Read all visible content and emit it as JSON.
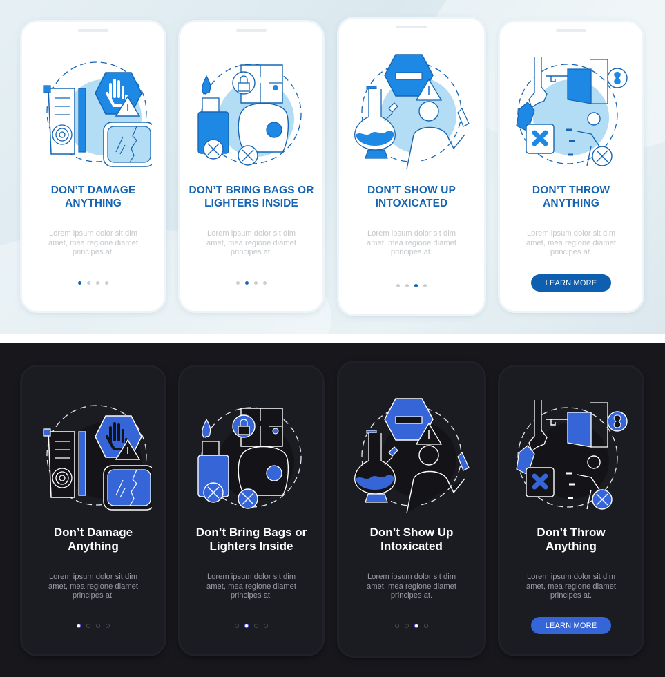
{
  "theme_light": {
    "colors": {
      "title": "#1565b4",
      "primary": "#1e88e5",
      "fill_light": "#b3dcf5",
      "outline": "#0f5fb0",
      "button": "#0f5fb0"
    },
    "cards": [
      {
        "title": "DON’T DAMAGE\nANYTHING",
        "title_line1": "DON’T DAMAGE",
        "title_line2": "ANYTHING",
        "description_line1": "Lorem ipsum dolor sit dim",
        "description_line2": "amet, mea regione diamet",
        "description_line3": "principes at.",
        "illustration": "damage-icon",
        "page_indicator": {
          "current": 1,
          "total": 4
        }
      },
      {
        "title_line1": "DON’T BRING BAGS OR",
        "title_line2": "LIGHTERS INSIDE",
        "description_line1": "Lorem ipsum dolor sit dim",
        "description_line2": "amet, mea regione diamet",
        "description_line3": "principes at.",
        "illustration": "bags-lighters-icon",
        "page_indicator": {
          "current": 2,
          "total": 4
        }
      },
      {
        "title_line1": "DON’T SHOW UP",
        "title_line2": "INTOXICATED",
        "description_line1": "Lorem ipsum dolor sit dim",
        "description_line2": "amet, mea regione diamet",
        "description_line3": "principes at.",
        "illustration": "intoxicated-icon",
        "page_indicator": {
          "current": 3,
          "total": 4
        }
      },
      {
        "title_line1": "DON’T THROW",
        "title_line2": "ANYTHING",
        "description_line1": "Lorem ipsum dolor sit dim",
        "description_line2": "amet, mea regione diamet",
        "description_line3": "principes at.",
        "illustration": "throw-icon",
        "button_label": "LEARN MORE"
      }
    ]
  },
  "theme_dark": {
    "colors": {
      "background": "#17171c",
      "card": "#1b1b22",
      "accent": "#3565d6",
      "outline": "#ffffff",
      "title": "#ffffff"
    },
    "cards": [
      {
        "title_line1": "Don’t Damage",
        "title_line2": "Anything",
        "description_line1": "Lorem ipsum dolor sit dim",
        "description_line2": "amet, mea regione diamet",
        "description_line3": "principes at.",
        "illustration": "damage-icon",
        "page_indicator": {
          "current": 1,
          "total": 4
        }
      },
      {
        "title_line1": "Don’t Bring Bags or",
        "title_line2": "Lighters Inside",
        "description_line1": "Lorem ipsum dolor sit dim",
        "description_line2": "amet, mea regione diamet",
        "description_line3": "principes at.",
        "illustration": "bags-lighters-icon",
        "page_indicator": {
          "current": 2,
          "total": 4
        }
      },
      {
        "title_line1": "Don’t Show Up",
        "title_line2": "Intoxicated",
        "description_line1": "Lorem ipsum dolor sit dim",
        "description_line2": "amet, mea regione diamet",
        "description_line3": "principes at.",
        "illustration": "intoxicated-icon",
        "page_indicator": {
          "current": 3,
          "total": 4
        }
      },
      {
        "title_line1": "Don’t Throw",
        "title_line2": "Anything",
        "description_line1": "Lorem ipsum dolor sit dim",
        "description_line2": "amet, mea regione diamet",
        "description_line3": "principes at.",
        "illustration": "throw-icon",
        "button_label": "LEARN MORE"
      }
    ]
  }
}
